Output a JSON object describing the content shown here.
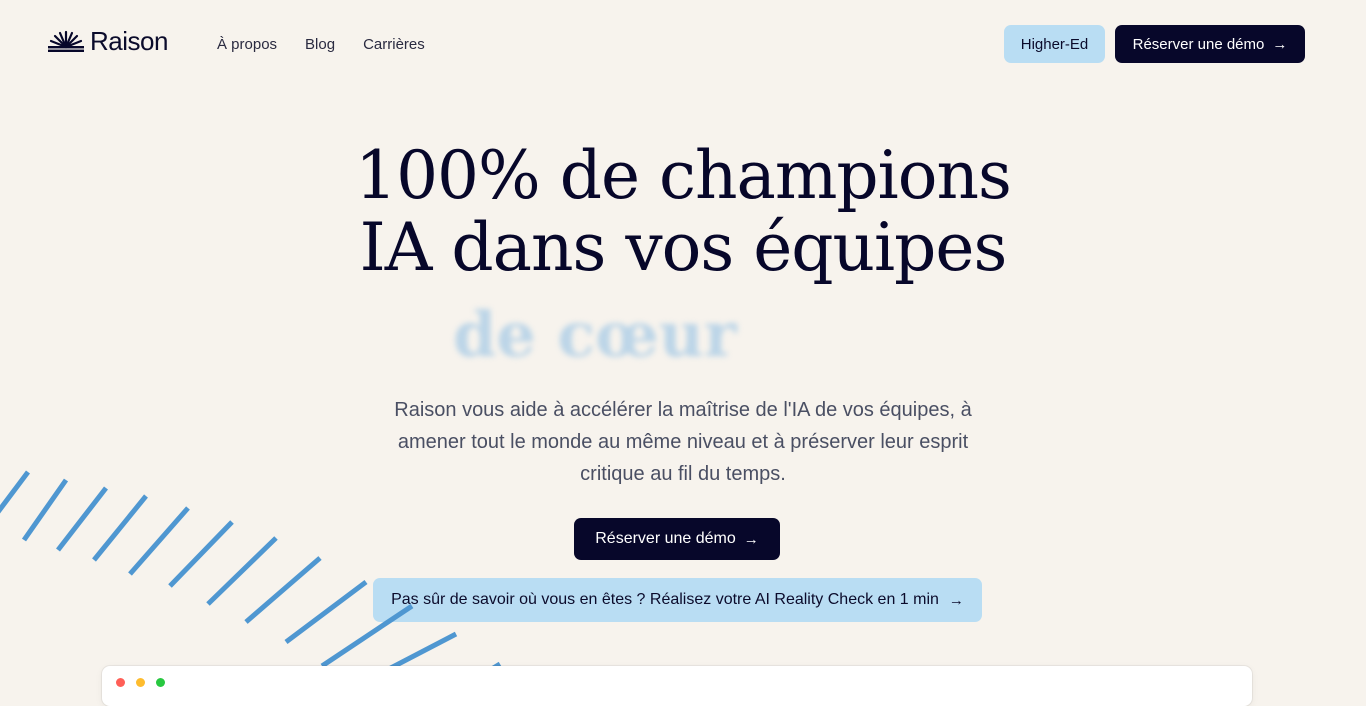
{
  "brand": {
    "name": "Raison",
    "icon": "sunrise-logo-icon"
  },
  "nav": {
    "links": [
      "À propos",
      "Blog",
      "Carrières"
    ],
    "higher_ed_label": "Higher-Ed",
    "demo_label": "Réserver une démo"
  },
  "hero": {
    "title_line1": "100% de champions",
    "title_line2": "IA dans vos équipes",
    "animated_word": "de cœur",
    "subtitle": "Raison vous aide à accélérer la maîtrise de l'IA de vos équipes, à amener tout le monde au même niveau et à préserver leur esprit critique au fil du temps.",
    "cta_label": "Réserver une démo",
    "reality_check_label": "Pas sûr de savoir où vous en êtes ? Réalisez votre AI Reality Check en 1 min"
  },
  "colors": {
    "background": "#f7f3ed",
    "navy": "#07072a",
    "light_blue": "#b9ddf3",
    "stripe_blue": "#4f97d1"
  },
  "icons": {
    "arrow": "→",
    "window_controls": [
      "#ff5f57",
      "#febc2e",
      "#28c840"
    ]
  }
}
